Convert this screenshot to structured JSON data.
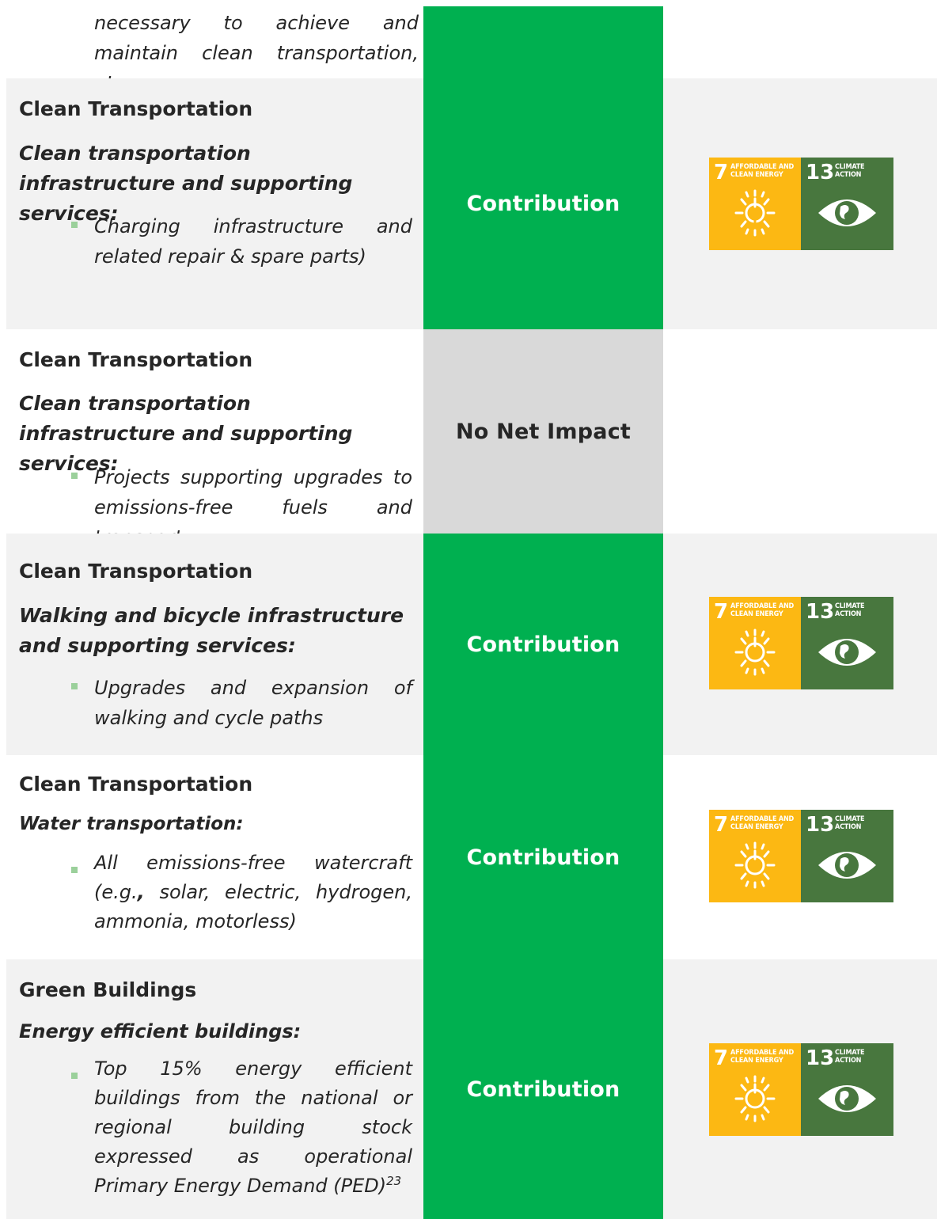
{
  "top_continuation": "necessary to achieve and maintain clean transportation, etc.",
  "rows": [
    {
      "category": "Clean Transportation",
      "subcategory": "Clean transportation infrastructure and supporting services:",
      "bullet": "Charging infrastructure and related repair & spare parts)",
      "assessment": "Contribution"
    },
    {
      "category": "Clean Transportation",
      "subcategory": "Clean transportation infrastructure and supporting services:",
      "bullet": "Projects supporting upgrades to emissions-free fuels and transport",
      "assessment": "No Net Impact"
    },
    {
      "category": "Clean Transportation",
      "subcategory": "Walking and bicycle infrastructure and supporting services:",
      "bullet": "Upgrades and expansion of walking and cycle paths",
      "assessment": "Contribution"
    },
    {
      "category": "Clean Transportation",
      "subcategory": "Water transportation:",
      "bullet_pre": "All emissions-free watercraft (e.g.",
      "bullet_bold": ",",
      "bullet_post": " solar, electric, hydrogen, ammonia, motorless)",
      "assessment": "Contribution"
    },
    {
      "category": "Green Buildings",
      "subcategory": "Energy efficient buildings:",
      "bullet": "Top 15% energy efficient buildings from the national or regional building stock expressed as operational Primary Energy Demand (PED)",
      "footnote": "23",
      "assessment": "Contribution"
    }
  ],
  "sdg": {
    "goal7_number": "7",
    "goal7_title_1": "AFFORDABLE AND",
    "goal7_title_2": "CLEAN ENERGY",
    "goal13_number": "13",
    "goal13_title_1": "CLIMATE",
    "goal13_title_2": "ACTION",
    "goal7_color": "#fcb813",
    "goal13_color": "#48773e"
  },
  "colors": {
    "contribution": "#00b050",
    "no_net_impact": "#d9d9d9",
    "row_shade": "#f2f2f2"
  }
}
